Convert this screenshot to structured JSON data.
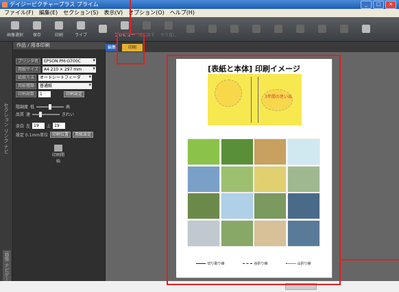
{
  "window": {
    "title": "デイジーピクチャープラス プライム",
    "controls": [
      "_",
      "□",
      "×"
    ]
  },
  "menu": [
    "ファイル(F)",
    "編集(E)",
    "セクション(S)",
    "表示(V)",
    "オプション(O)",
    "ヘルプ(H)"
  ],
  "toolbar": [
    {
      "label": "画像選択",
      "enabled": true
    },
    {
      "label": "保存",
      "enabled": true
    },
    {
      "label": "印刷",
      "enabled": true
    },
    {
      "label": "ライブ",
      "enabled": true
    },
    {
      "label": "",
      "enabled": true
    },
    {
      "label": "プレビュー",
      "enabled": true
    },
    {
      "label": "元に戻す",
      "enabled": false
    },
    {
      "label": "やり直し",
      "enabled": false
    },
    {
      "label": "",
      "enabled": false
    },
    {
      "label": "",
      "enabled": false
    },
    {
      "label": "",
      "enabled": false
    },
    {
      "label": "",
      "enabled": false
    },
    {
      "label": "",
      "enabled": false
    },
    {
      "label": "",
      "enabled": false
    },
    {
      "label": "",
      "enabled": false
    },
    {
      "label": "",
      "enabled": false
    },
    {
      "label": "",
      "enabled": true
    }
  ],
  "left_strip": {
    "top_label": "セクション リンク ナビ",
    "bottom_label": "画像 ナビゲート"
  },
  "panel": {
    "title": "作品 / 用本印刷",
    "printer_label": "プリンタ名",
    "printer_value": "EPSON PM-G700C",
    "paper_size_label": "用紙サイズ",
    "paper_size_value": "A4 210 × 297 mm",
    "feed_label": "給紙方法",
    "feed_value": "オートシートフィーダ",
    "paper_type_label": "用紙種類",
    "paper_type_value": "普通紙",
    "copies_label": "印刷部数",
    "copies_value": "1",
    "detail_button": "印刷設定",
    "color_label": "階調度",
    "color_low": "低",
    "color_high": "高",
    "quality_label": "品質",
    "quality_low": "速",
    "quality_high": "きれい",
    "offset_label": "余白",
    "offset_x_label": "左",
    "offset_x": "19",
    "offset_y_label": "上",
    "offset_y": "19",
    "unit_label": "設定 0.1mm単位",
    "btn1": "印刷位置",
    "btn2": "用紙設定",
    "print_button": "印刷開始"
  },
  "tabs": {
    "left": "編集",
    "right": "印刷"
  },
  "preview": {
    "title": "[表紙と本体] 印刷イメージ",
    "cover_text": "3年間の思い出",
    "legend": [
      "切り取り線",
      "谷折り線",
      "山折り線"
    ]
  },
  "colors": {
    "highlight": "#e02020",
    "cover": "#f8e850",
    "tab_active": "#e6b030"
  }
}
